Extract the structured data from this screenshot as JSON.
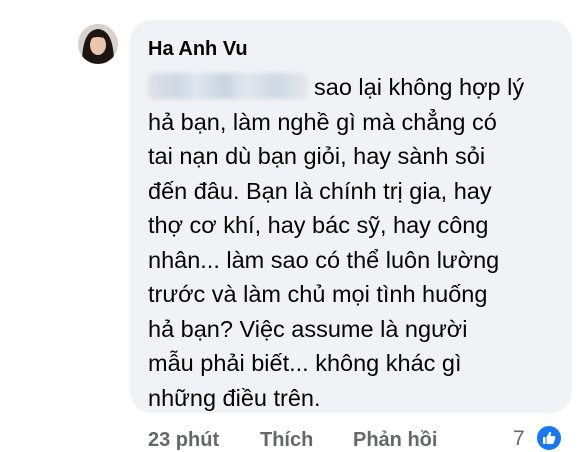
{
  "comment": {
    "author": "Ha Anh Vu",
    "text": "sao lại không hợp lý\nhả bạn, làm nghề gì mà chẳng có\ntai nạn dù bạn giỏi, hay sành sỏi\nđến đâu. Bạn là chính trị gia, hay\nthợ cơ khí, hay bác sỹ, hay công\nnhân... làm sao có thể luôn lường\ntrước và làm chủ mọi tình huống\nhả bạn? Việc assume là người\nmẫu phải biết... không khác gì\nnhững điều trên.",
    "time": "23 phút",
    "like_label": "Thích",
    "reply_label": "Phản hồi",
    "reaction_count": "7",
    "reaction_icon": "like-icon",
    "colors": {
      "bubble": "#f0f2f5",
      "text": "#050505",
      "meta": "#65676b",
      "like": "#1877f2"
    }
  }
}
